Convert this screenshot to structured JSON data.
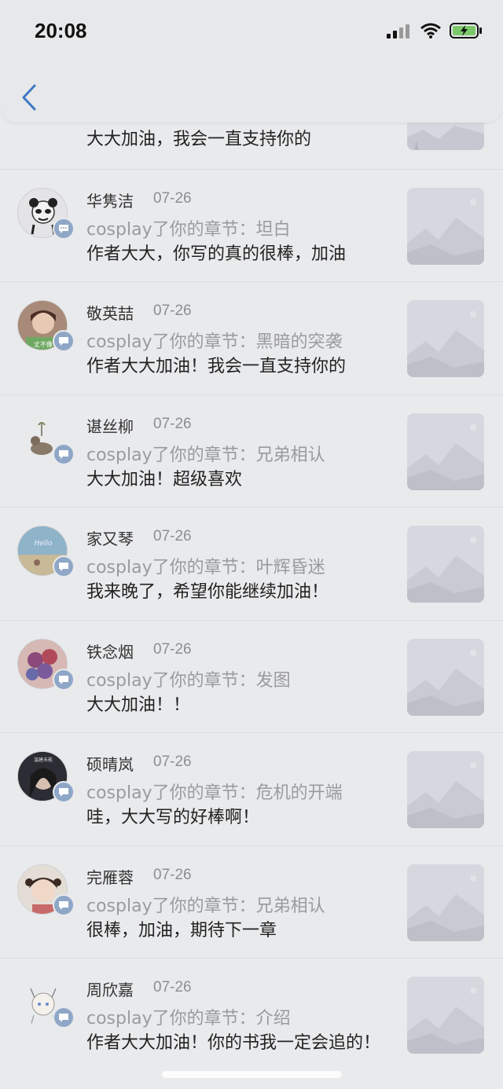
{
  "status": {
    "time": "20:08"
  },
  "nav": {
    "back_icon": "chevron-left-icon",
    "accent": "#3f78c6"
  },
  "items": [
    {
      "name": "",
      "date": "",
      "chapter_prefix": "",
      "chapter": "",
      "comment": "大大加油，我会一直支持你的"
    },
    {
      "name": "华隽洁",
      "date": "07-26",
      "chapter_prefix": "cosplay了你的章节：",
      "chapter": "坦白",
      "comment": "作者大大，你写的真的很棒，加油"
    },
    {
      "name": "敬英喆",
      "date": "07-26",
      "chapter_prefix": "cosplay了你的章节：",
      "chapter": "黑暗的突袭",
      "comment": "作者大大加油！我会一直支持你的"
    },
    {
      "name": "谌丝柳",
      "date": "07-26",
      "chapter_prefix": "cosplay了你的章节：",
      "chapter": "兄弟相认",
      "comment": "大大加油！超级喜欢"
    },
    {
      "name": "家又琴",
      "date": "07-26",
      "chapter_prefix": "cosplay了你的章节：",
      "chapter": "叶辉昏迷",
      "comment": "我来晚了，希望你能继续加油！"
    },
    {
      "name": "铁念烟",
      "date": "07-26",
      "chapter_prefix": "cosplay了你的章节：",
      "chapter": "发图",
      "comment": "大大加油！！"
    },
    {
      "name": "硕晴岚",
      "date": "07-26",
      "chapter_prefix": "cosplay了你的章节：",
      "chapter": "危机的开端",
      "comment": "哇，大大写的好棒啊！"
    },
    {
      "name": "完雁蓉",
      "date": "07-26",
      "chapter_prefix": "cosplay了你的章节：",
      "chapter": "兄弟相认",
      "comment": "很棒，加油，期待下一章"
    },
    {
      "name": "周欣嘉",
      "date": "07-26",
      "chapter_prefix": "cosplay了你的章节：",
      "chapter": "介绍",
      "comment": "作者大大加油！你的书我一定会追的！"
    }
  ]
}
